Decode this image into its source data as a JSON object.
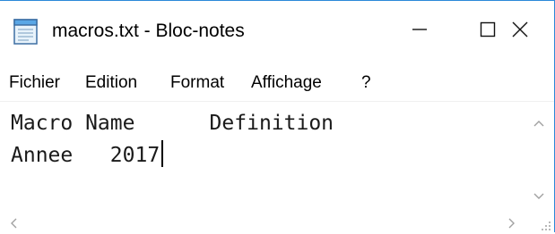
{
  "window": {
    "title": "macros.txt - Bloc-notes",
    "icon": "notepad-icon",
    "border_color": "#2b88d8"
  },
  "title_controls": {
    "minimize_icon": "minimize-icon",
    "maximize_icon": "maximize-icon",
    "close_icon": "close-icon"
  },
  "menubar": {
    "items": [
      {
        "label": "Fichier"
      },
      {
        "label": "Edition"
      },
      {
        "label": "Format"
      },
      {
        "label": "Affichage"
      },
      {
        "label": "?"
      }
    ]
  },
  "document": {
    "lines": [
      "Macro Name      Definition",
      "Annee   2017"
    ]
  },
  "scrollbars": {
    "up_arrow_icon": "chevron-up-icon",
    "down_arrow_icon": "chevron-down-icon",
    "left_arrow_icon": "chevron-left-icon",
    "right_arrow_icon": "chevron-right-icon",
    "size_grip_icon": "size-grip-icon"
  }
}
